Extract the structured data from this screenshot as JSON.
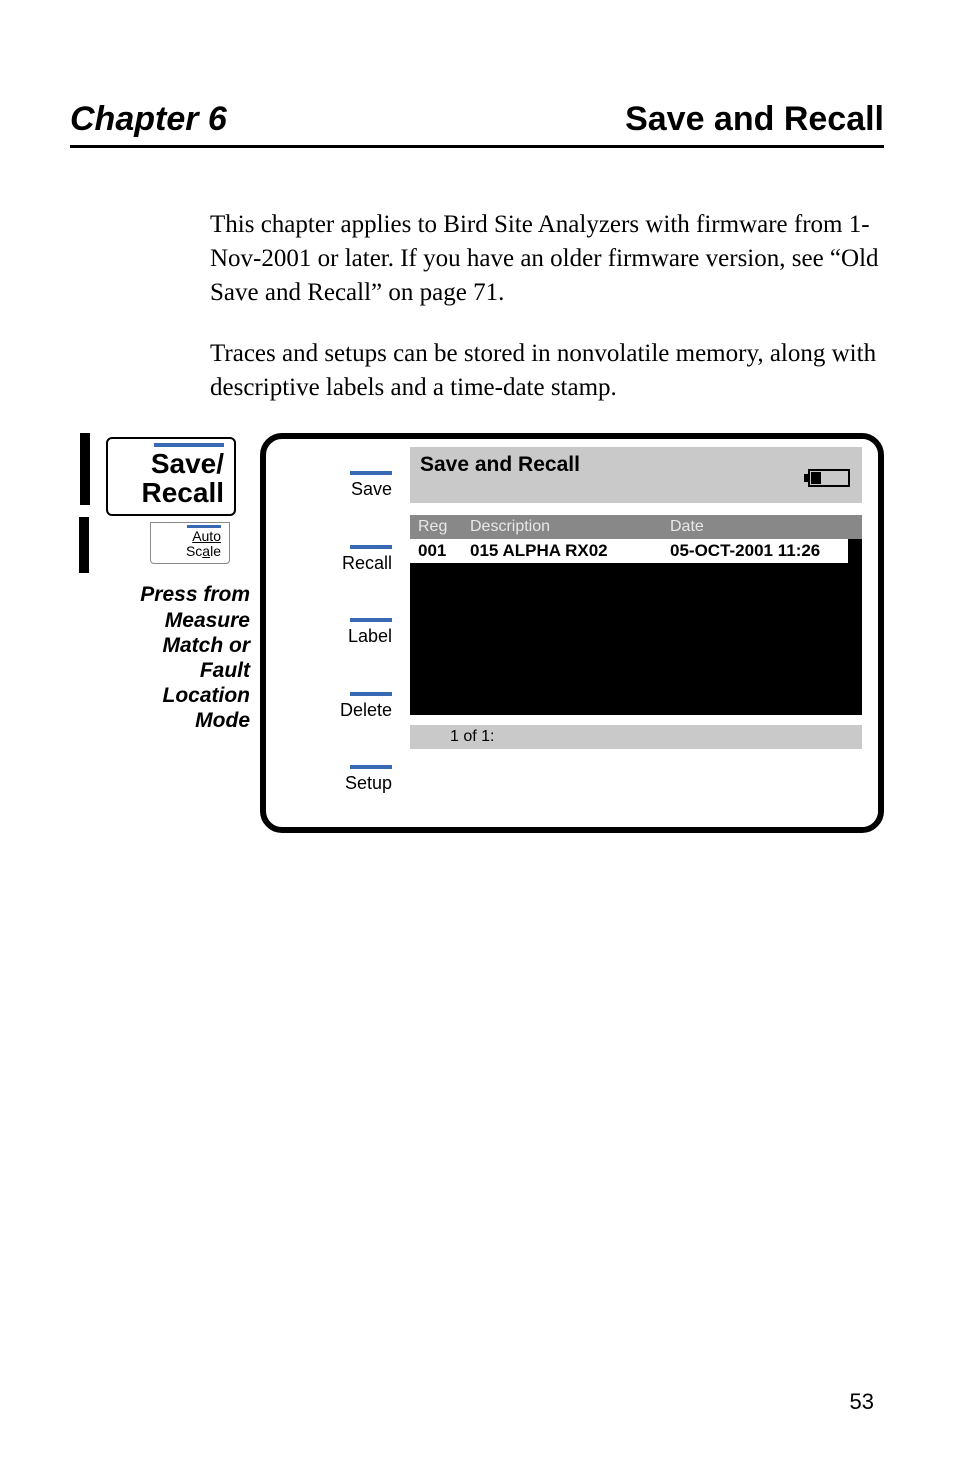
{
  "header": {
    "chapter_label": "Chapter 6",
    "chapter_title": "Save and Recall"
  },
  "paragraphs": {
    "p1": "This chapter applies to Bird Site Analyzers with firmware from 1-Nov-2001 or later. If you have an older firmware version, see “Old Save and Recall” on page 71.",
    "p2": "Traces and setups can be stored in nonvolatile memory, along with descriptive labels and a time-date stamp."
  },
  "left_panel": {
    "save_recall_line1": "Save/",
    "save_recall_line2": "Recall",
    "auto_label": "Auto",
    "scale_label": "Scale",
    "caption_l1": "Press from",
    "caption_l2": "Measure",
    "caption_l3": "Match or",
    "caption_l4": "Fault",
    "caption_l5": "Location",
    "caption_l6": "Mode"
  },
  "softkeys": {
    "k1": "Save",
    "k2": "Recall",
    "k3": "Label",
    "k4": "Delete",
    "k5": "Setup"
  },
  "screen": {
    "title": "Save and Recall",
    "col_reg": "Reg",
    "col_desc": "Description",
    "col_date": "Date",
    "row1_reg": "001",
    "row1_desc": "015 ALPHA RX02",
    "row1_date": "05-OCT-2001 11:26",
    "footer": "1 of 1:"
  },
  "page_number": "53"
}
